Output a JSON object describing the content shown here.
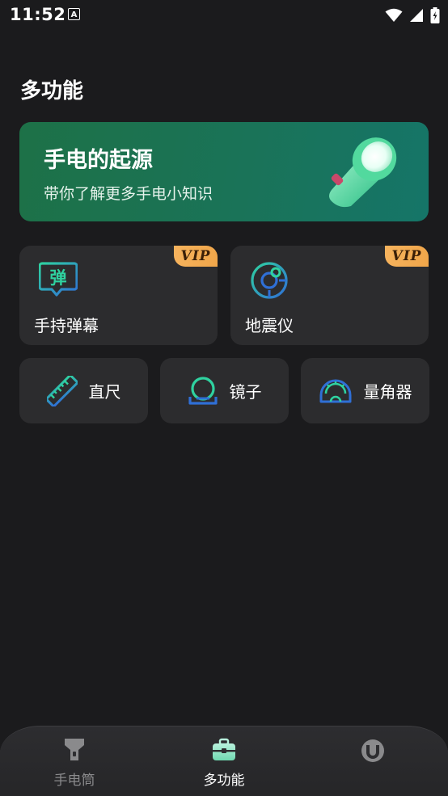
{
  "status_bar": {
    "time": "11:52",
    "notification_glyph": "A"
  },
  "page": {
    "title": "多功能"
  },
  "banner": {
    "title": "手电的起源",
    "subtitle": "带你了解更多手电小知识",
    "icon": "flashlight-icon"
  },
  "features_large": [
    {
      "label": "手持弹幕",
      "badge": "VIP",
      "icon": "bullet-chat-icon",
      "icon_text": "弹"
    },
    {
      "label": "地震仪",
      "badge": "VIP",
      "icon": "seismometer-icon"
    }
  ],
  "features_small": [
    {
      "label": "直尺",
      "icon": "ruler-icon"
    },
    {
      "label": "镜子",
      "icon": "mirror-icon"
    },
    {
      "label": "量角器",
      "icon": "protractor-icon"
    }
  ],
  "bottom_nav": [
    {
      "label": "手电筒",
      "icon": "flashlight-icon",
      "active": false
    },
    {
      "label": "多功能",
      "icon": "toolbox-icon",
      "active": true
    },
    {
      "label": "",
      "icon": "profile-icon",
      "active": false
    }
  ],
  "colors": {
    "background": "#1b1b1d",
    "card": "#2c2c2e",
    "banner_start": "#1d7147",
    "banner_end": "#157568",
    "vip_badge": "#f6b35d",
    "icon_teal": "#26c6a2",
    "icon_blue": "#2f6fd6"
  }
}
